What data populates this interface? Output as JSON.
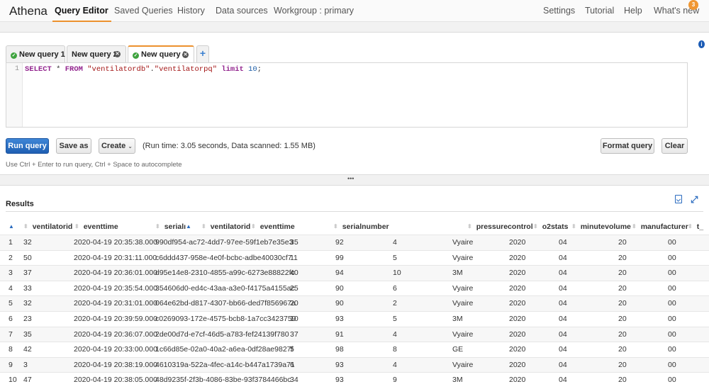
{
  "app": {
    "brand": "Athena"
  },
  "nav": {
    "items": [
      {
        "label": "Query Editor",
        "active": true
      },
      {
        "label": "Saved Queries"
      },
      {
        "label": "History"
      },
      {
        "label": "Data sources"
      },
      {
        "label": "Workgroup : primary"
      }
    ],
    "right_items": [
      {
        "label": "Settings"
      },
      {
        "label": "Tutorial"
      },
      {
        "label": "Help"
      },
      {
        "label": "What's new",
        "badge": "3"
      }
    ]
  },
  "tabs": [
    {
      "label": "New query 1",
      "status": "success",
      "closable": false
    },
    {
      "label": "New query 2",
      "closable": true
    },
    {
      "label": "New query 3",
      "status": "success",
      "closable": true,
      "active": true
    },
    {
      "label": "+"
    }
  ],
  "editor": {
    "line_number": "1",
    "tokens": {
      "select": "SELECT",
      "star": " * ",
      "from": "FROM",
      "space": " ",
      "db": "\"ventilatordb\"",
      "dot": ".",
      "table": "\"ventilatorpq\"",
      "limit": " limit ",
      "n": "10",
      "semi": ";"
    }
  },
  "toolbar": {
    "run_label": "Run query",
    "save_as_label": "Save as",
    "create_label": "Create",
    "run_info": "(Run time: 3.05 seconds, Data scanned: 1.55 MB)",
    "format_label": "Format query",
    "clear_label": "Clear",
    "hint": "Use Ctrl + Enter to run query, Ctrl + Space to autocomplete"
  },
  "splitter": {
    "handle": "•••"
  },
  "results": {
    "title": "Results",
    "columns": [
      "",
      "ventilatorid",
      "eventtime",
      "serialı",
      "",
      "ventilatorid",
      "eventtime",
      "serialnumber",
      "pressurecontrol",
      "o2stats",
      "minutevolume",
      "manufacturer",
      "t_"
    ],
    "rows": [
      [
        "1",
        "32",
        "2020-04-19 20:35:38.000",
        "990df954-ac72-4dd7-97ee-59f1eb7e35e3",
        "35",
        "92",
        "4",
        "Vyaire",
        "2020",
        "04",
        "20",
        "00"
      ],
      [
        "2",
        "50",
        "2020-04-19 20:31:11.000",
        "c6ddd437-958e-4e0f-bcbc-adbe40030cf7",
        "11",
        "99",
        "5",
        "Vyaire",
        "2020",
        "04",
        "20",
        "00"
      ],
      [
        "3",
        "37",
        "2020-04-19 20:36:01.000",
        "d95e14e8-2310-4855-a99c-6273e88822fc",
        "40",
        "94",
        "10",
        "3M",
        "2020",
        "04",
        "20",
        "00"
      ],
      [
        "4",
        "33",
        "2020-04-19 20:35:54.000",
        "354606d0-ed4c-43aa-a3e0-f4175a4155ac",
        "25",
        "90",
        "6",
        "Vyaire",
        "2020",
        "04",
        "20",
        "00"
      ],
      [
        "5",
        "32",
        "2020-04-19 20:31:01.000",
        "064e62bd-d817-4307-bb66-ded7f856967a",
        "20",
        "90",
        "2",
        "Vyaire",
        "2020",
        "04",
        "20",
        "00"
      ],
      [
        "6",
        "23",
        "2020-04-19 20:39:59.000",
        "c0269093-172e-4575-bcb8-1a7cc3423759",
        "10",
        "93",
        "5",
        "3M",
        "2020",
        "04",
        "20",
        "00"
      ],
      [
        "7",
        "35",
        "2020-04-19 20:36:07.000",
        "2de00d7d-e7cf-46d5-a783-fef24139f780",
        "37",
        "91",
        "4",
        "Vyaire",
        "2020",
        "04",
        "20",
        "00"
      ],
      [
        "8",
        "42",
        "2020-04-19 20:33:00.000",
        "1c66d85e-02a0-40a2-a6ea-0df28ae9827f",
        "5",
        "98",
        "8",
        "GE",
        "2020",
        "04",
        "20",
        "00"
      ],
      [
        "9",
        "3",
        "2020-04-19 20:38:19.000",
        "4610319a-522a-4fec-a14c-b447a1739a71",
        "6",
        "93",
        "4",
        "Vyaire",
        "2020",
        "04",
        "20",
        "00"
      ],
      [
        "10",
        "47",
        "2020-04-19 20:38:05.000",
        "48d9235f-2f3b-4086-83be-93f3784466bc",
        "34",
        "93",
        "9",
        "3M",
        "2020",
        "04",
        "20",
        "00"
      ]
    ]
  },
  "colors": {
    "accent": "#ec912d",
    "primary_button": "#1f5fb3",
    "link": "#2a6bbf"
  }
}
